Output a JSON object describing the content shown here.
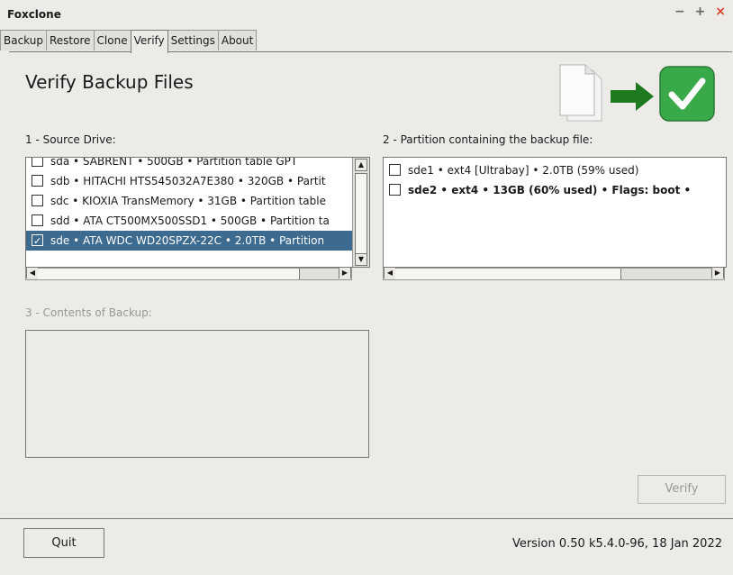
{
  "window": {
    "title": "Foxclone",
    "controls": [
      "−",
      "+",
      "×"
    ]
  },
  "tabs": [
    {
      "label": "Backup",
      "active": false
    },
    {
      "label": "Restore",
      "active": false
    },
    {
      "label": "Clone",
      "active": false
    },
    {
      "label": "Verify",
      "active": true
    },
    {
      "label": "Settings",
      "active": false
    },
    {
      "label": "About",
      "active": false
    }
  ],
  "page": {
    "heading": "Verify Backup Files",
    "header_icons": [
      "document-icon",
      "arrow-right-icon",
      "checkmark-icon"
    ],
    "accent_colors": {
      "arrow": "#1e7a1e",
      "check": "#3aa94a"
    }
  },
  "source_drive": {
    "label": "1 - Source Drive:",
    "items": [
      {
        "text": "sda • SABRENT • 500GB • Partition table GPT",
        "checked": false,
        "selected": false
      },
      {
        "text": "sdb • HITACHI HTS545032A7E380 • 320GB • Partit",
        "checked": false,
        "selected": false
      },
      {
        "text": "sdc • KIOXIA TransMemory • 31GB • Partition table",
        "checked": false,
        "selected": false
      },
      {
        "text": "sdd • ATA CT500MX500SSD1 • 500GB • Partition ta",
        "checked": false,
        "selected": false
      },
      {
        "text": "sde • ATA WDC WD20SPZX-22C • 2.0TB • Partition",
        "checked": true,
        "selected": true
      }
    ]
  },
  "partition": {
    "label": "2 - Partition containing the backup file:",
    "items": [
      {
        "text": "sde1 • ext4 [Ultrabay] • 2.0TB (59% used)",
        "checked": false,
        "bold": false
      },
      {
        "text": "sde2 • ext4 • 13GB (60% used) • Flags: boot •",
        "checked": false,
        "bold": true
      }
    ]
  },
  "contents": {
    "label": "3 - Contents of Backup:"
  },
  "buttons": {
    "verify": "Verify",
    "quit": "Quit"
  },
  "status": {
    "version": "Version 0.50 k5.4.0-96, 18 Jan 2022"
  }
}
